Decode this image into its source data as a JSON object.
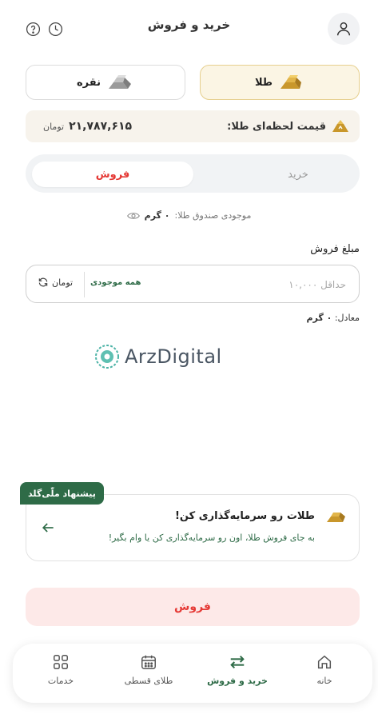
{
  "header": {
    "title": "خرید و فروش",
    "icons": [
      "user-icon",
      "clock-icon",
      "help-icon"
    ]
  },
  "metals": {
    "gold_label": "طلا",
    "silver_label": "نقره",
    "selected": "gold"
  },
  "price": {
    "label": "قیمت لحظه‌ای طلا:",
    "value": "۲۱,۷۸۷,۶۱۵",
    "unit": "تومان"
  },
  "trade_tabs": {
    "buy_label": "خرید",
    "sell_label": "فروش",
    "selected": "sell"
  },
  "balance": {
    "label": "موجودی صندوق طلا:",
    "value": "۰ گرم"
  },
  "amount": {
    "label": "مبلغ فروش",
    "placeholder": "حداقل ۱۰,۰۰۰",
    "all_balance_label": "همه موجودی",
    "unit_label": "تومان"
  },
  "equivalent": {
    "label": "معادل:",
    "value": "۰ گرم"
  },
  "watermark": {
    "text": "ArzDigital"
  },
  "offer": {
    "badge": "پیشنهاد ملّی‌گلد",
    "title": "طلات رو سرمایه‌گذاری کن!",
    "description": "به جای فروش طلا، اون رو سرمایه‌گذاری کن یا وام بگیر!"
  },
  "action": {
    "sell_button": "فروش"
  },
  "nav": {
    "items": [
      {
        "label": "خانه",
        "icon": "home-icon"
      },
      {
        "label": "خرید و فروش",
        "icon": "swap-icon",
        "active": true
      },
      {
        "label": "طلای قسطی",
        "icon": "calendar-icon"
      },
      {
        "label": "خدمات",
        "icon": "grid-icon"
      }
    ]
  },
  "colors": {
    "brand_green": "#2e6b47",
    "sell_red": "#e53935",
    "gold_accent": "#e6cf8e"
  }
}
